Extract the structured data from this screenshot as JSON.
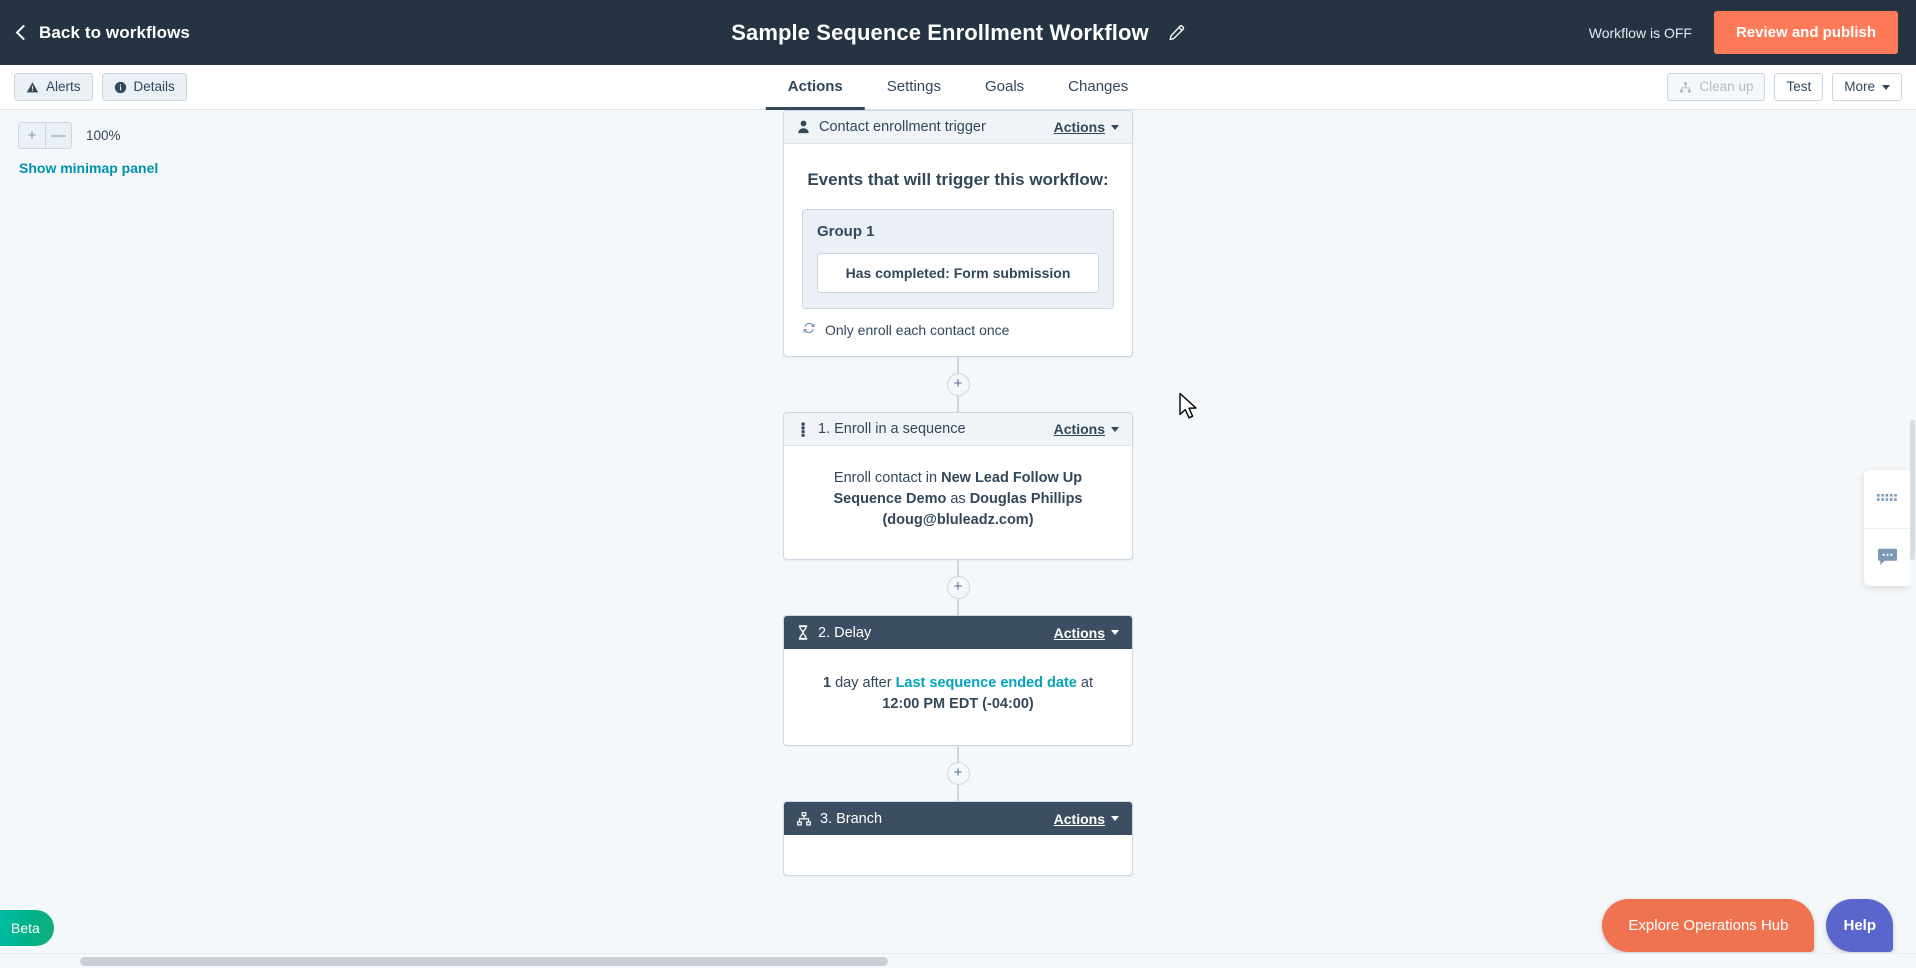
{
  "topbar": {
    "back_label": "Back to workflows",
    "title": "Sample Sequence Enrollment Workflow",
    "edit_icon": "pencil-icon",
    "status_text": "Workflow is OFF",
    "publish_label": "Review and publish",
    "accent_color": "#ff7a59",
    "background_color": "#253342"
  },
  "toolbar": {
    "alerts_label": "Alerts",
    "details_label": "Details",
    "cleanup_label": "Clean up",
    "test_label": "Test",
    "more_label": "More",
    "tabs": [
      {
        "label": "Actions",
        "active": true
      },
      {
        "label": "Settings",
        "active": false
      },
      {
        "label": "Goals",
        "active": false
      },
      {
        "label": "Changes",
        "active": false
      }
    ]
  },
  "canvas": {
    "zoom_in_label": "+",
    "zoom_out_label": "—",
    "zoom_level": "100%",
    "minimap_link": "Show minimap panel",
    "plus_label": "+",
    "link_color": "#0091ae"
  },
  "flow": {
    "trigger": {
      "header_title": "Contact enrollment trigger",
      "header_icon": "contact-icon",
      "actions_label": "Actions",
      "heading": "Events that will trigger this workflow:",
      "group_title": "Group 1",
      "criterion": "Has completed: Form submission",
      "enroll_once": "Only enroll each contact once",
      "enroll_once_icon": "refresh-icon"
    },
    "steps": [
      {
        "header_title": "1. Enroll in a sequence",
        "header_icon": "sequence-icon",
        "actions_label": "Actions",
        "theme": "light",
        "body_prefix": "Enroll contact in ",
        "body_sequence": "New Lead Follow Up Sequence Demo",
        "body_mid": " as ",
        "body_person": "Douglas Phillips",
        "body_email": "(doug@bluleadz.com)"
      },
      {
        "header_title": "2. Delay",
        "header_icon": "hourglass-icon",
        "actions_label": "Actions",
        "theme": "dark",
        "delay_amount": "1",
        "delay_unit": " day after ",
        "delay_property": "Last sequence ended date",
        "delay_at": " at",
        "delay_time": "12:00 PM EDT (-04:00)"
      },
      {
        "header_title": "3. Branch",
        "header_icon": "branch-icon",
        "actions_label": "Actions",
        "theme": "dark"
      }
    ]
  },
  "dock": {
    "items": [
      {
        "icon": "apps-grid-icon"
      },
      {
        "icon": "chat-bubble-icon"
      }
    ]
  },
  "floating": {
    "beta_label": "Beta",
    "ops_hub_label": "Explore Operations Hub",
    "help_label": "Help",
    "ops_hub_color": "#ef7351",
    "help_color": "#5a66cc",
    "beta_color": "#00bda5"
  }
}
